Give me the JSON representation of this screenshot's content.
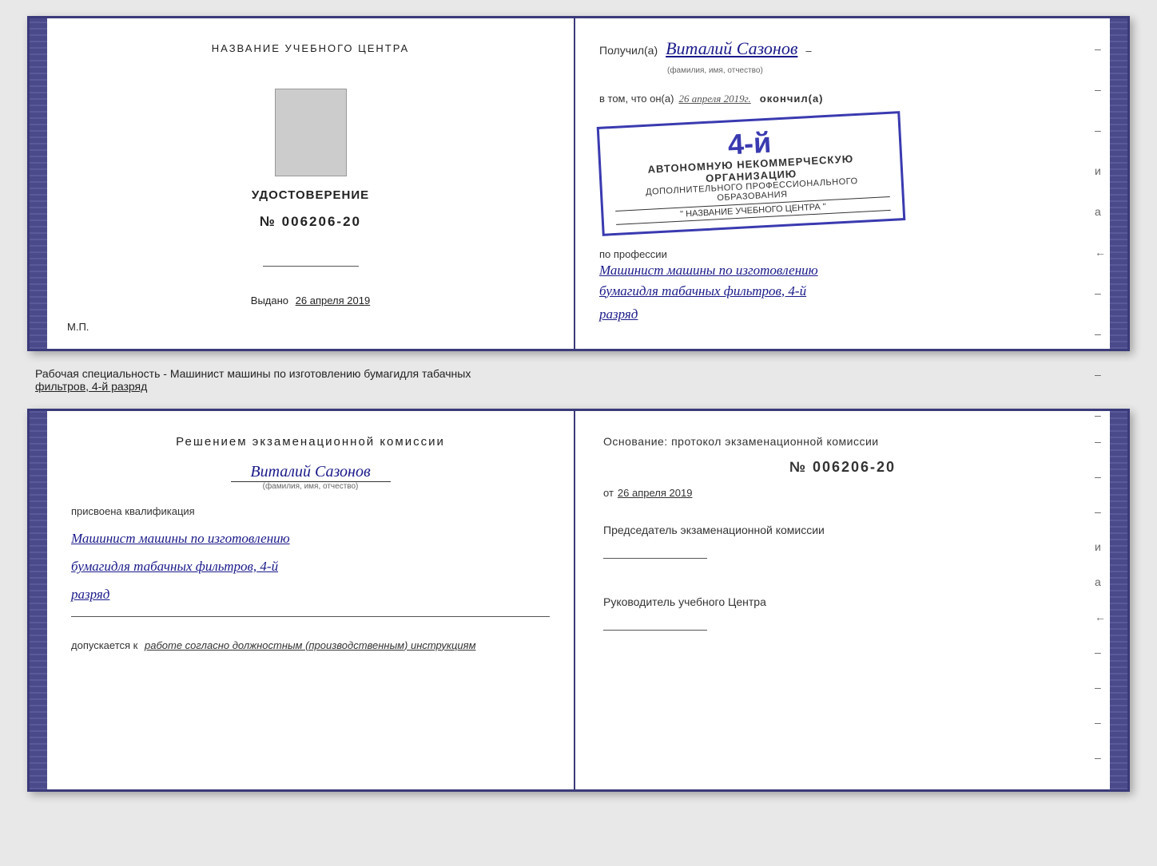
{
  "top_doc": {
    "left_page": {
      "center_title": "НАЗВАНИЕ УЧЕБНОГО ЦЕНТРА",
      "cert_label": "УДОСТОВЕРЕНИЕ",
      "cert_number": "№ 006206-20",
      "issued_label": "Выдано",
      "issued_date": "26 апреля 2019",
      "mp_label": "М.П."
    },
    "right_page": {
      "received_label": "Получил(а)",
      "recipient_name": "Виталий Сазонов",
      "name_hint": "(фамилия, имя, отчество)",
      "in_that_prefix": "в том, что он(а)",
      "date_handwritten": "26 апреля 2019г.",
      "finished_label": "окончил(а)",
      "stamp_number": "4-й",
      "stamp_line1": "АВТОНОМНУЮ НЕКОММЕРЧЕСКУЮ ОРГАНИЗАЦИЮ",
      "stamp_line2": "ДОПОЛНИТЕЛЬНОГО ПРОФЕССИОНАЛЬНОГО ОБРАЗОВАНИЯ",
      "stamp_org_name": "\" НАЗВАНИЕ УЧЕБНОГО ЦЕНТРА \"",
      "profession_label": "по профессии",
      "profession_text": "Машинист машины по изготовлению",
      "profession_text2": "бумагидля табачных фильтров, 4-й",
      "profession_text3": "разряд",
      "dashes": [
        "-",
        "-",
        "-",
        "и",
        "а",
        "←",
        "-",
        "-",
        "-",
        "-",
        "-"
      ]
    }
  },
  "label_section": {
    "text_prefix": "Рабочая специальность - Машинист машины по изготовлению бумагидля табачных",
    "text_underline": "фильтров, 4-й разряд"
  },
  "bottom_doc": {
    "left_page": {
      "decision_title": "Решением  экзаменационной  комиссии",
      "name": "Виталий Сазонов",
      "name_hint": "(фамилия, имя, отчество)",
      "assigned_label": "присвоена квалификация",
      "qual1": "Машинист машины по изготовлению",
      "qual2": "бумагидля табачных фильтров, 4-й",
      "qual3": "разряд",
      "admitted_prefix": "допускается к",
      "admitted_text": "работе согласно должностным (производственным) инструкциям"
    },
    "right_page": {
      "basis_label": "Основание: протокол экзаменационной  комиссии",
      "number_label": "№  006206-20",
      "from_prefix": "от",
      "from_date": "26 апреля 2019",
      "chairman_label": "Председатель экзаменационной комиссии",
      "director_label": "Руководитель учебного Центра",
      "dashes": [
        "-",
        "-",
        "-",
        "и",
        "а",
        "←",
        "-",
        "-",
        "-",
        "-",
        "-"
      ]
    }
  }
}
